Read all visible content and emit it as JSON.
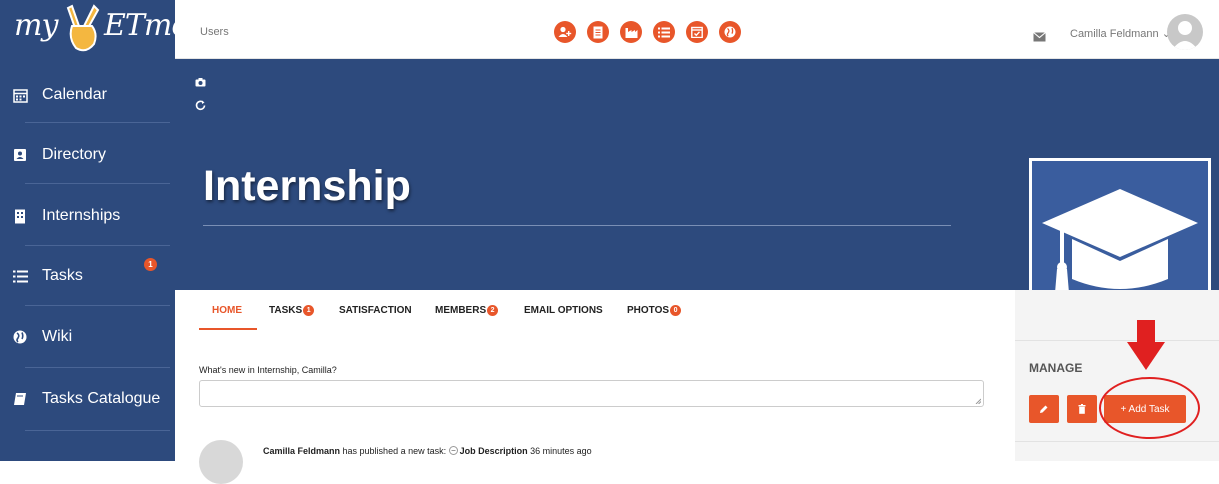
{
  "app": {
    "logo_text_left": "my",
    "logo_text_right": "ETmo"
  },
  "topbar": {
    "breadcrumb": "Users",
    "user_name": "Camilla Feldmann",
    "user_caret": "⌄"
  },
  "top_icons": [
    "add-user-icon",
    "document-icon",
    "factory-icon",
    "task-list-icon",
    "calendar-check-icon",
    "globe-icon"
  ],
  "sidebar": {
    "items": [
      {
        "label": "Calendar",
        "icon": "calendar-icon"
      },
      {
        "label": "Directory",
        "icon": "contact-book-icon"
      },
      {
        "label": "Internships",
        "icon": "building-icon"
      },
      {
        "label": "Tasks",
        "icon": "list-icon",
        "badge": "1"
      },
      {
        "label": "Wiki",
        "icon": "globe-icon"
      },
      {
        "label": "Tasks Catalogue",
        "icon": "book-icon"
      }
    ]
  },
  "cover": {
    "title": "Internship"
  },
  "tabs": [
    {
      "label": "HOME",
      "active": true
    },
    {
      "label": "TASKS",
      "badge": "1"
    },
    {
      "label": "SATISFACTION"
    },
    {
      "label": "MEMBERS",
      "badge": "2"
    },
    {
      "label": "EMAIL OPTIONS"
    },
    {
      "label": "PHOTOS",
      "badge": "0"
    }
  ],
  "activity": {
    "prompt": "What's new in Internship, Camilla?",
    "post_author": "Camilla Feldmann",
    "post_action": " has published a new task: ",
    "post_object": "Job Description",
    "post_time": " 36 minutes ago"
  },
  "manage": {
    "label": "MANAGE",
    "add_task_label": "+ Add Task"
  },
  "colors": {
    "primary": "#2d4a7d",
    "accent": "#e8562a",
    "annotation": "#e02020"
  }
}
